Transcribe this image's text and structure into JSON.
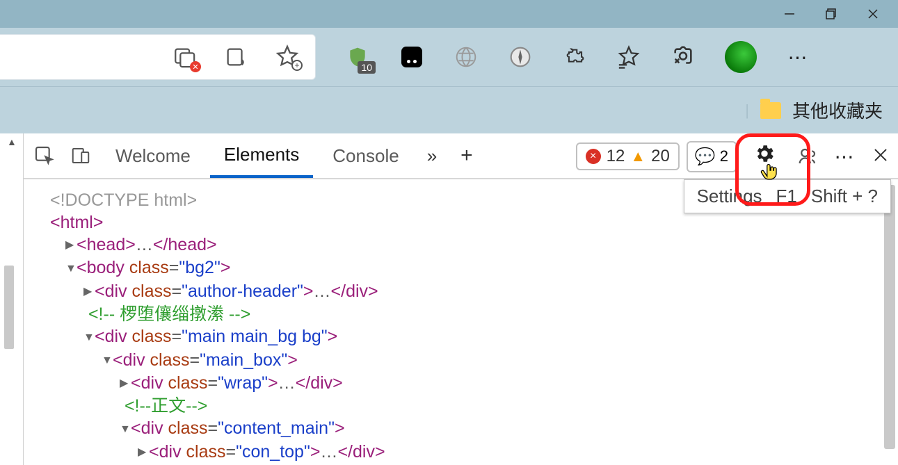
{
  "window": {
    "minimize": "—",
    "maximize": "❐",
    "close": "✕"
  },
  "toolbar": {
    "shield_badge": "10",
    "menu_dots": "⋯"
  },
  "bookmarks": {
    "other_label": "其他收藏夹"
  },
  "devtools": {
    "tabs": {
      "welcome": "Welcome",
      "elements": "Elements",
      "console": "Console",
      "more": "»",
      "plus": "+"
    },
    "issues": {
      "errors": "12",
      "warnings": "20"
    },
    "feedback_count": "2",
    "tooltip": {
      "label": "Settings",
      "key1": "F1",
      "key2": "Shift + ?"
    },
    "more_dots": "⋯",
    "close": "✕"
  },
  "dom": {
    "l1": "<!DOCTYPE html>",
    "l2_open": "<",
    "l2_tag": "html",
    "l2_close": ">",
    "l3_open": "<",
    "l3_tag": "head",
    "l3_close": ">",
    "l3_ell": "…",
    "l3_endopen": "</",
    "l3_endclose": ">",
    "l4_open": "<",
    "l4_tag": "body",
    "l4_attr": "class",
    "l4_val": "\"bg2\"",
    "l4_close": ">",
    "l5_open": "<",
    "l5_tag": "div",
    "l5_attr": "class",
    "l5_val": "\"author-header\"",
    "l5_close": ">",
    "l5_ell": "…",
    "l5_endopen": "</",
    "l5_endclose": ">",
    "l6": "<!-- 椤堕儴缁撴潫 -->",
    "l7_open": "<",
    "l7_tag": "div",
    "l7_attr": "class",
    "l7_val": "\"main main_bg bg\"",
    "l7_close": ">",
    "l8_open": "<",
    "l8_tag": "div",
    "l8_attr": "class",
    "l8_val": "\"main_box\"",
    "l8_close": ">",
    "l9_open": "<",
    "l9_tag": "div",
    "l9_attr": "class",
    "l9_val": "\"wrap\"",
    "l9_close": ">",
    "l9_ell": "…",
    "l9_endopen": "</",
    "l9_endclose": ">",
    "l10": "<!--正文-->",
    "l11_open": "<",
    "l11_tag": "div",
    "l11_attr": "class",
    "l11_val": "\"content_main\"",
    "l11_close": ">",
    "l12_open": "<",
    "l12_tag": "div",
    "l12_attr": "class",
    "l12_val": "\"con_top\"",
    "l12_close": ">",
    "l12_ell": "…",
    "l12_endopen": "</",
    "l12_endclose": ">"
  }
}
